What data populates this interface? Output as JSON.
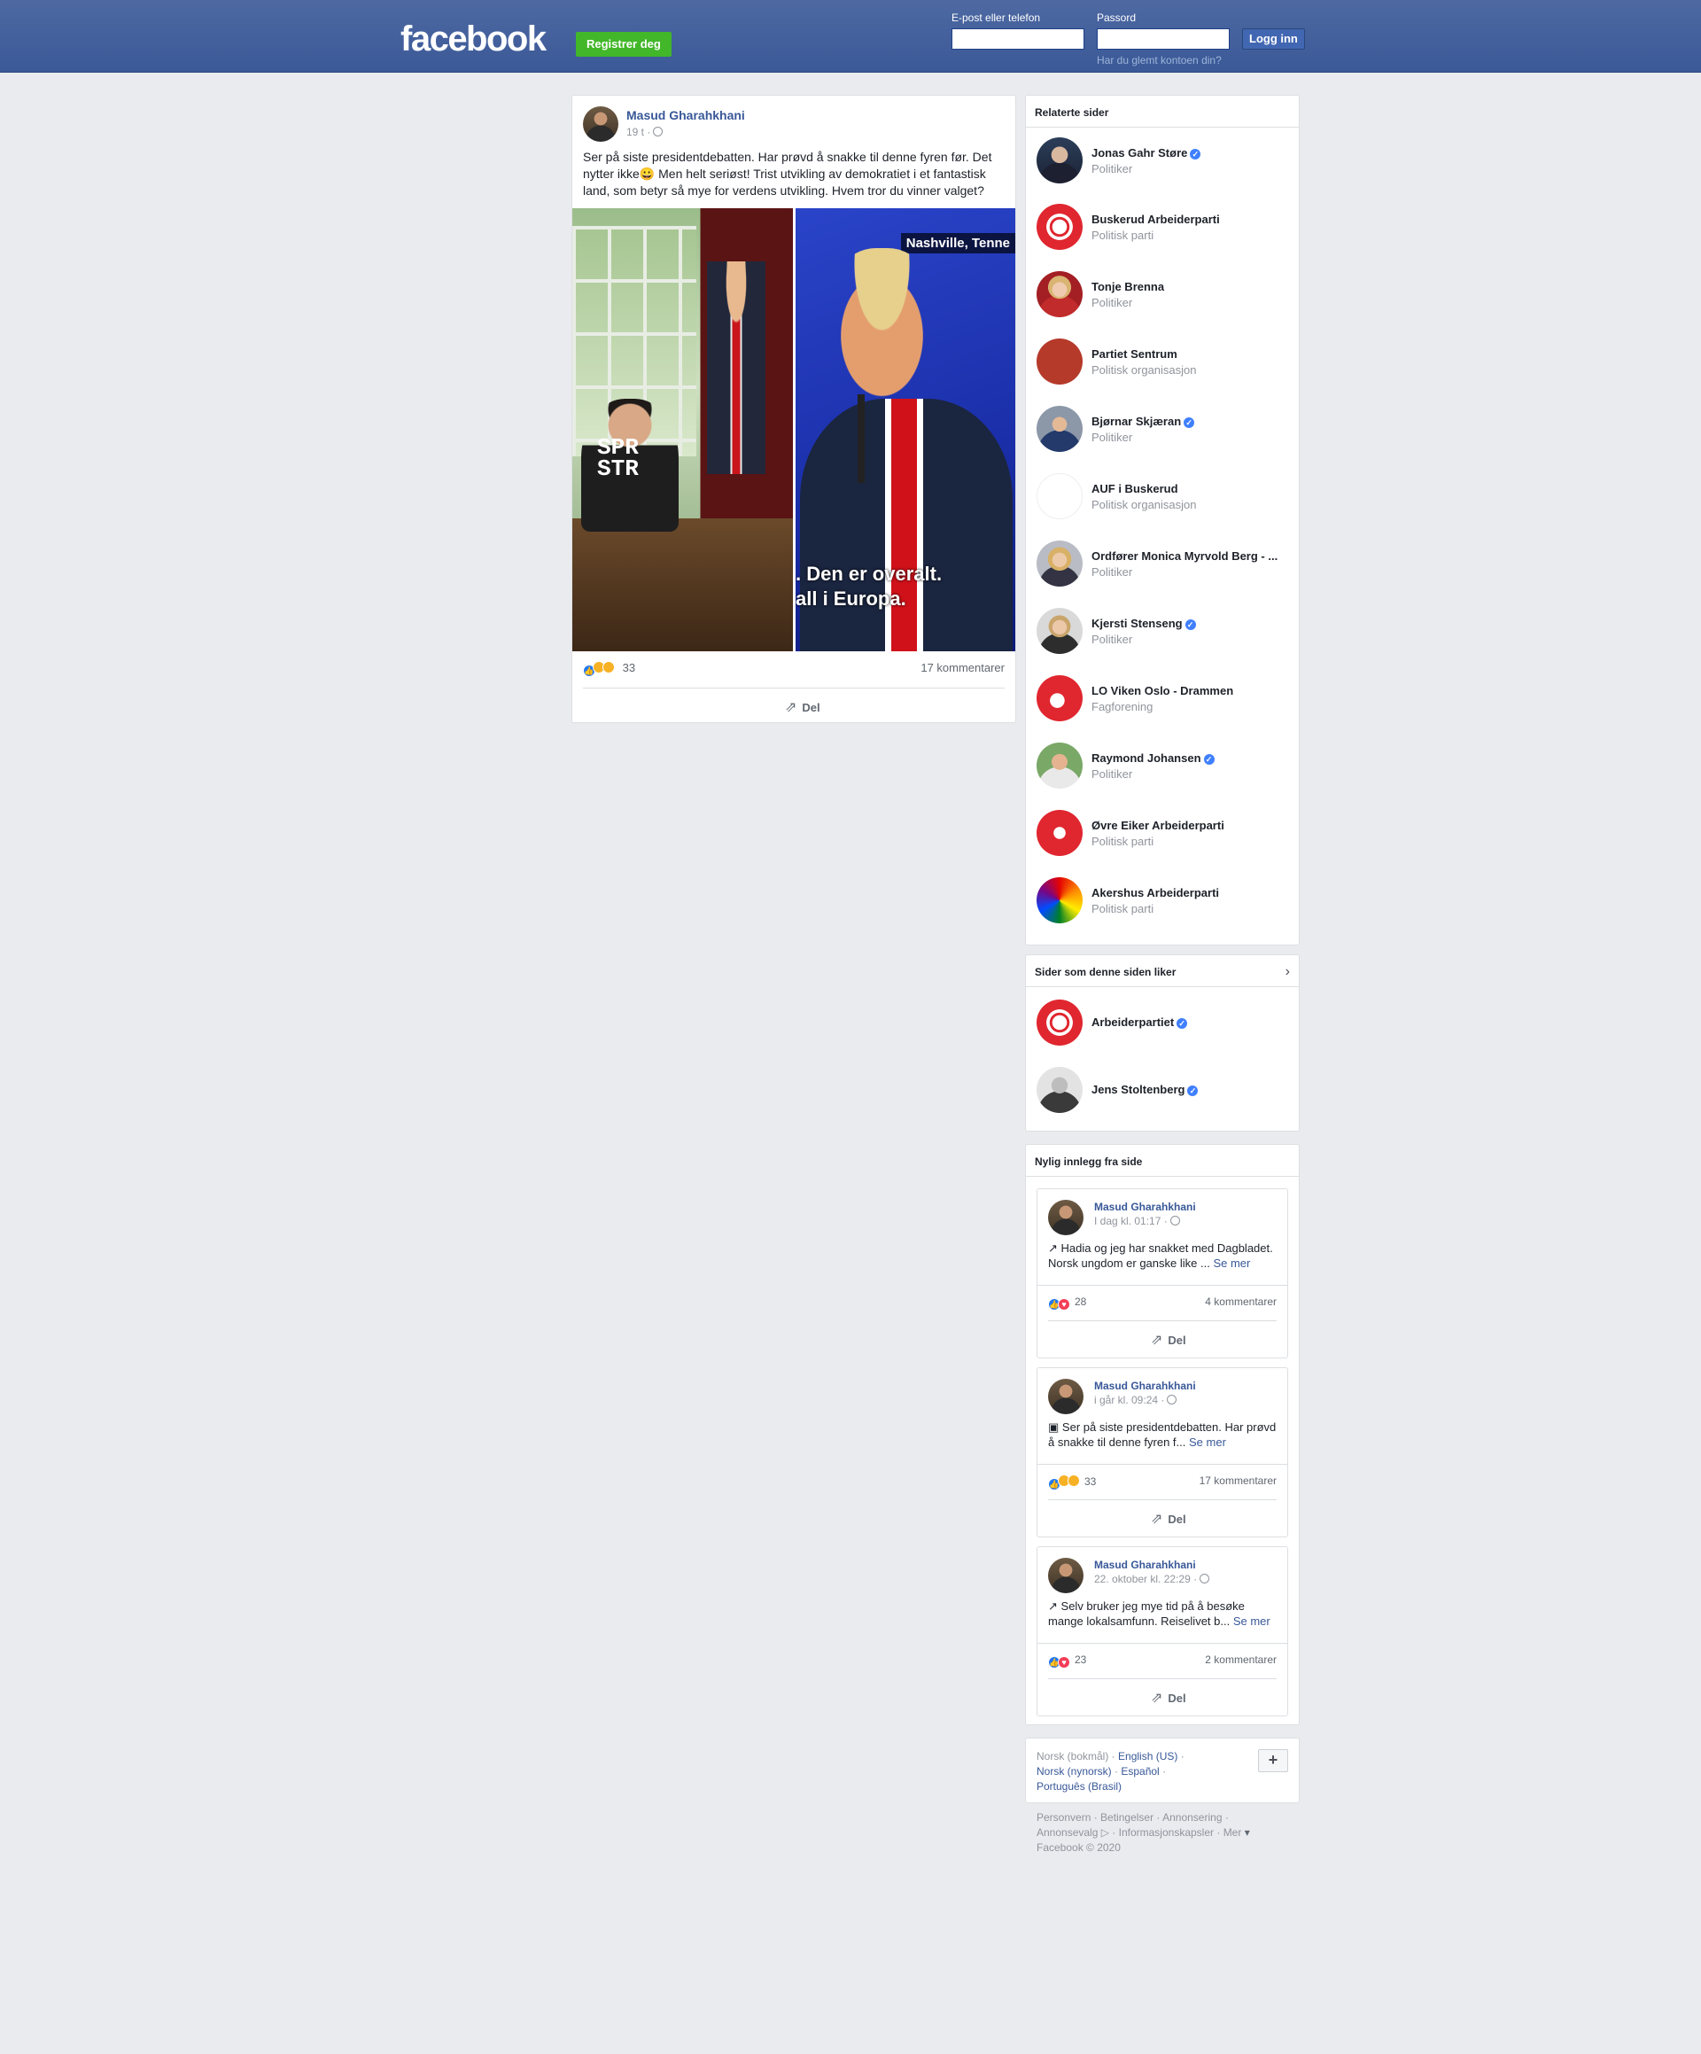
{
  "header": {
    "logo": "facebook",
    "register_label": "Registrer deg",
    "email_label": "E-post eller telefon",
    "password_label": "Passord",
    "login_label": "Logg inn",
    "forgot_label": "Har du glemt kontoen din?"
  },
  "post": {
    "author": "Masud Gharahkhani",
    "time": "19 t ·",
    "text": "Ser på siste presidentdebatten. Har prøvd å snakke til denne fyren før. Det nytter ikke😀 Men helt seriøst! Trist utvikling av demokratiet i et fantastisk land, som betyr så mye for verdens utvikling. Hvem tror du vinner valget?",
    "image_left_text": "SPR\nSTR",
    "image_right_location": "Nashville, Tenne",
    "image_right_sub1": ". Den er overalt.",
    "image_right_sub2": "all i Europa.",
    "reactions_count": "33",
    "comments": "17 kommentarer",
    "share_label": "Del"
  },
  "related": {
    "title": "Relaterte sider",
    "items": [
      {
        "name": "Jonas Gahr Støre",
        "sub": "Politiker",
        "verified": true
      },
      {
        "name": "Buskerud Arbeiderparti",
        "sub": "Politisk parti",
        "verified": false
      },
      {
        "name": "Tonje Brenna",
        "sub": "Politiker",
        "verified": false
      },
      {
        "name": "Partiet Sentrum",
        "sub": "Politisk organisasjon",
        "verified": false
      },
      {
        "name": "Bjørnar Skjæran",
        "sub": "Politiker",
        "verified": true
      },
      {
        "name": "AUF i Buskerud",
        "sub": "Politisk organisasjon",
        "verified": false
      },
      {
        "name": "Ordfører Monica Myrvold Berg - ...",
        "sub": "Politiker",
        "verified": false
      },
      {
        "name": "Kjersti Stenseng",
        "sub": "Politiker",
        "verified": true
      },
      {
        "name": "LO Viken Oslo - Drammen",
        "sub": "Fagforening",
        "verified": false
      },
      {
        "name": "Raymond Johansen",
        "sub": "Politiker",
        "verified": true
      },
      {
        "name": "Øvre Eiker Arbeiderparti",
        "sub": "Politisk parti",
        "verified": false
      },
      {
        "name": "Akershus Arbeiderparti",
        "sub": "Politisk parti",
        "verified": false
      }
    ]
  },
  "likes": {
    "title": "Sider som denne siden liker",
    "items": [
      {
        "name": "Arbeiderpartiet",
        "verified": true
      },
      {
        "name": "Jens Stoltenberg",
        "verified": true
      }
    ]
  },
  "recent": {
    "title": "Nylig innlegg fra side",
    "posts": [
      {
        "author": "Masud Gharahkhani",
        "time": "I dag kl. 01:17 ·",
        "icon": "↗",
        "text": "Hadia og jeg har snakket med Dagbladet. Norsk ungdom er ganske like ...",
        "more": "Se mer",
        "count": "28",
        "comments": "4 kommentarer",
        "share": "Del"
      },
      {
        "author": "Masud Gharahkhani",
        "time": "i går kl. 09:24 ·",
        "icon": "▣",
        "text": "Ser på siste presidentdebatten. Har prøvd å snakke til denne fyren f...",
        "more": "Se mer",
        "count": "33",
        "comments": "17 kommentarer",
        "share": "Del"
      },
      {
        "author": "Masud Gharahkhani",
        "time": "22. oktober kl. 22:29 ·",
        "icon": "↗",
        "text": "Selv bruker jeg mye tid på å besøke mange lokalsamfunn. Reiselivet b...",
        "more": "Se mer",
        "count": "23",
        "comments": "2 kommentarer",
        "share": "Del"
      }
    ]
  },
  "languages": {
    "current": "Norsk (bokmål) ·",
    "links": [
      "English (US)",
      "Norsk (nynorsk)",
      "Español",
      "Português (Brasil)"
    ]
  },
  "footer": {
    "links": [
      "Personvern",
      "Betingelser",
      "Annonsering",
      "Annonsevalg",
      "Informasjonskapsler",
      "Mer"
    ],
    "copyright": "Facebook © 2020"
  }
}
